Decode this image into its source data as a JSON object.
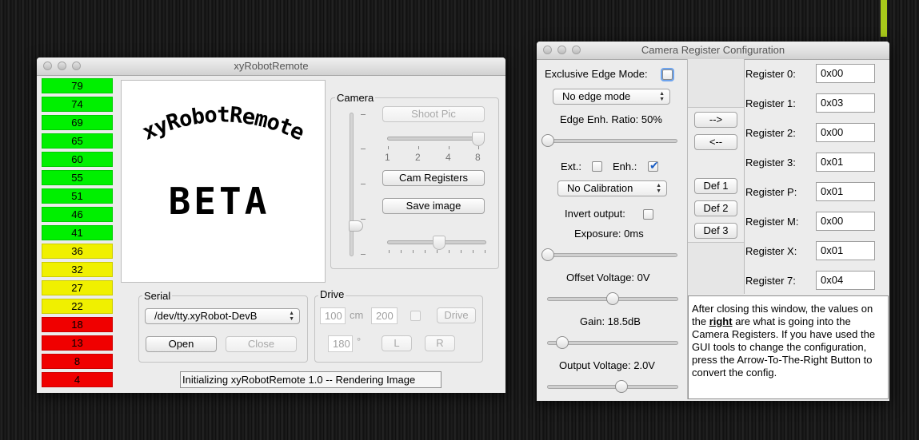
{
  "main_window": {
    "title": "xyRobotRemote",
    "meter_values": [
      "79",
      "74",
      "69",
      "65",
      "60",
      "55",
      "51",
      "46",
      "41",
      "36",
      "32",
      "27",
      "22",
      "18",
      "13",
      "8",
      "4"
    ],
    "meter_colors": {
      "high": "#00f000",
      "mid": "#f0f000",
      "low": "#f00000"
    },
    "preview": {
      "heading": "xyRobotRemote",
      "subtitle": "BETA"
    },
    "camera": {
      "group_label": "Camera",
      "shoot_pic": "Shoot Pic",
      "zoom_ticks": [
        "1",
        "2",
        "4",
        "8"
      ],
      "cam_registers": "Cam Registers",
      "save_image": "Save image"
    },
    "serial": {
      "group_label": "Serial",
      "port_selected": "/dev/tty.xyRobot-DevB",
      "open": "Open",
      "close": "Close"
    },
    "drive": {
      "group_label": "Drive",
      "distance": "100",
      "distance_unit": "cm",
      "speed": "200",
      "drive_button": "Drive",
      "angle": "180",
      "angle_unit": "°",
      "left": "L",
      "right": "R"
    },
    "status": "Initializing xyRobotRemote 1.0 -- Rendering Image"
  },
  "config_window": {
    "title": "Camera Register Configuration",
    "exclusive_edge_mode_label": "Exclusive Edge Mode:",
    "edge_mode_selected": "No edge mode",
    "edge_ratio_label": "Edge Enh. Ratio: 50%",
    "ext_label": "Ext.:",
    "enh_label": "Enh.:",
    "calibration_selected": "No Calibration",
    "invert_label": "Invert output:",
    "exposure_label": "Exposure: 0ms",
    "offset_label": "Offset Voltage: 0V",
    "gain_label": "Gain: 18.5dB",
    "output_voltage_label": "Output Voltage: 2.0V",
    "arrow_right": "-->",
    "arrow_left": "<--",
    "def1": "Def 1",
    "def2": "Def 2",
    "def3": "Def 3",
    "registers": [
      {
        "label": "Register 0:",
        "value": "0x00"
      },
      {
        "label": "Register 1:",
        "value": "0x03"
      },
      {
        "label": "Register 2:",
        "value": "0x00"
      },
      {
        "label": "Register 3:",
        "value": "0x01"
      },
      {
        "label": "Register P:",
        "value": "0x01"
      },
      {
        "label": "Register M:",
        "value": "0x00"
      },
      {
        "label": "Register X:",
        "value": "0x01"
      },
      {
        "label": "Register 7:",
        "value": "0x04"
      }
    ],
    "info": {
      "part1": "After closing this window, the values on the ",
      "emphasis": "right",
      "part2": " are what is going into the Camera Registers. If you have used the GUI tools to change the configuration, press the Arrow-To-The-Right Button to convert the config."
    }
  }
}
